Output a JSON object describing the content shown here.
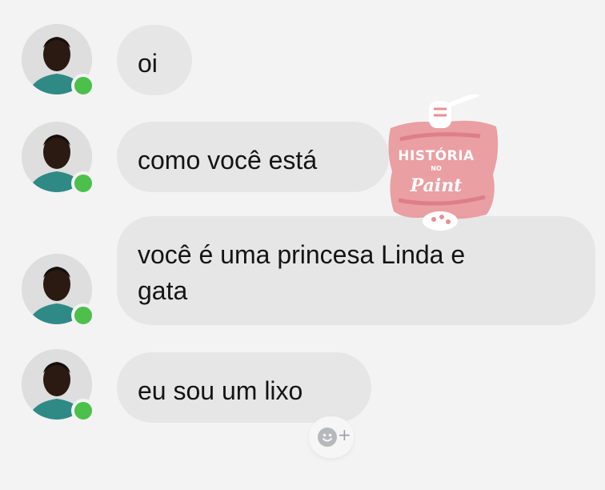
{
  "messages": [
    {
      "lines": [
        "oi"
      ]
    },
    {
      "lines": [
        "como você está"
      ]
    },
    {
      "lines": [
        "você é uma princesa Linda e",
        "gata"
      ]
    },
    {
      "lines": [
        "eu sou um lixo"
      ]
    }
  ],
  "watermark": {
    "line1": "HISTÓRIA",
    "line2": "NO",
    "line3": "Paint"
  },
  "reaction_button": {
    "icon": "add-reaction-icon",
    "symbol": "+"
  },
  "colors": {
    "background": "#f3f3f4",
    "bubble": "#e6e6e7",
    "online": "#4cc04a",
    "watermark_brush": "#e88f94"
  }
}
